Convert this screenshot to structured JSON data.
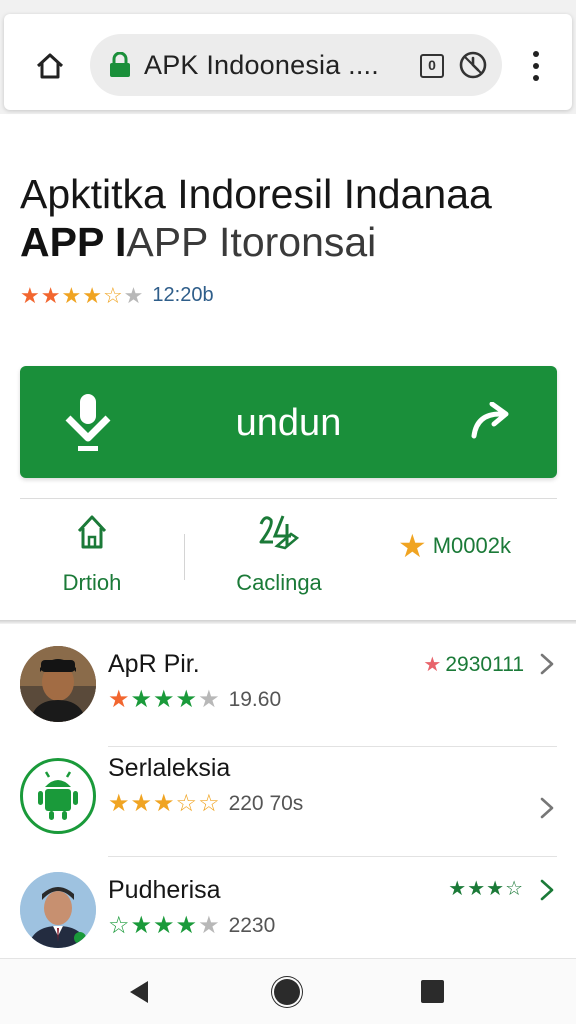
{
  "browser": {
    "url_text": "APK Indoonesia ....",
    "tab_count": "0",
    "icons": {
      "home": "home-icon",
      "lock": "lock-icon",
      "history": "clock-icon",
      "menu": "more-vert-icon"
    }
  },
  "app": {
    "title_line1": "Apktitka Indoresil Indanaa",
    "title_line2_bold": "APP I",
    "title_line2_light": "APP Itoronsai",
    "rating_stars": "★★★★☆",
    "rating_count": "12:20b"
  },
  "install": {
    "label": "undun",
    "icons": {
      "download": "download-icon",
      "share": "share-icon"
    },
    "color": "#1a8f3a"
  },
  "actions": [
    {
      "label": "Drtioh",
      "icon": "home-outline-icon"
    },
    {
      "label": "Caclinga",
      "icon": "category-icon"
    },
    {
      "label": "M0002k",
      "icon": "star-icon"
    }
  ],
  "list": [
    {
      "name": "ApR Pir.",
      "stars": "★★★★☆",
      "count": "19.60",
      "right_text": "2930111",
      "avatar": "person-avatar"
    },
    {
      "name": "Serlaleksia",
      "stars": "★★★☆☆",
      "count": "220 70s",
      "right_text": "",
      "avatar": "android-icon"
    },
    {
      "name": "Pudherisa",
      "stars": "★★★★☆",
      "count": "2230",
      "right_text": "",
      "right_stars": "★★★☆",
      "avatar": "person-avatar"
    }
  ],
  "nav": {
    "back": "back-icon",
    "home": "home-circle-icon",
    "recents": "recents-icon"
  }
}
